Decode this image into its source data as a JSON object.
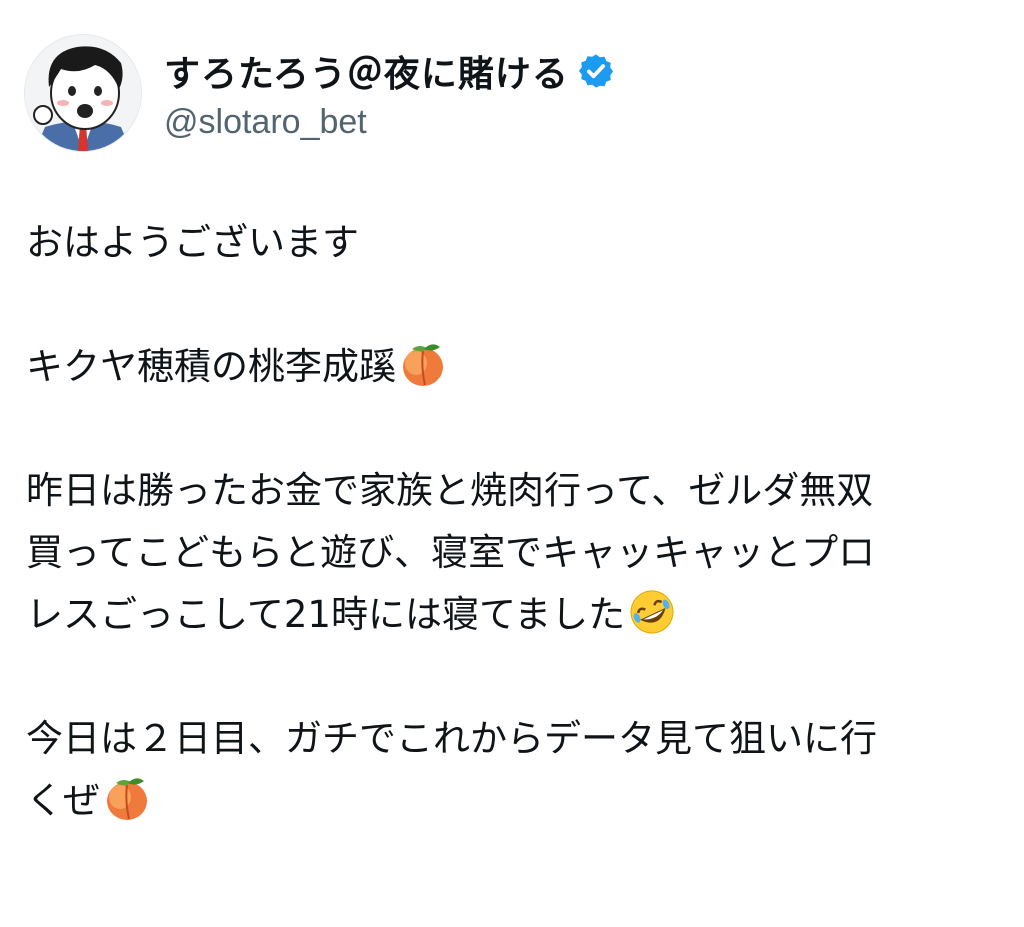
{
  "author": {
    "display_name": "すろたろう＠夜に賭ける",
    "handle": "@slotaro_bet",
    "verified_icon": "verified-badge-icon",
    "verified_color": "#1d9bf0",
    "avatar_icon": "cartoon-avatar-icon"
  },
  "tweet": {
    "line1": "おはようございます",
    "line2": "キクヤ穂積の桃李成蹊",
    "line3a": "昨日は勝ったお金で家族と焼肉行って、ゼルダ無双",
    "line3b": "買ってこどもらと遊び、寝室でキャッキャッとプロ",
    "line3c": "レスごっこして21時には寝てました",
    "line4a": "今日は２日目、ガチでこれからデータ見て狙いに行",
    "line4b": "くぜ",
    "emojis": [
      "peach-emoji-icon",
      "rofl-emoji-icon",
      "peach-emoji-icon"
    ]
  },
  "colors": {
    "text": "#0f1419",
    "handle": "#536471",
    "background": "#ffffff"
  }
}
